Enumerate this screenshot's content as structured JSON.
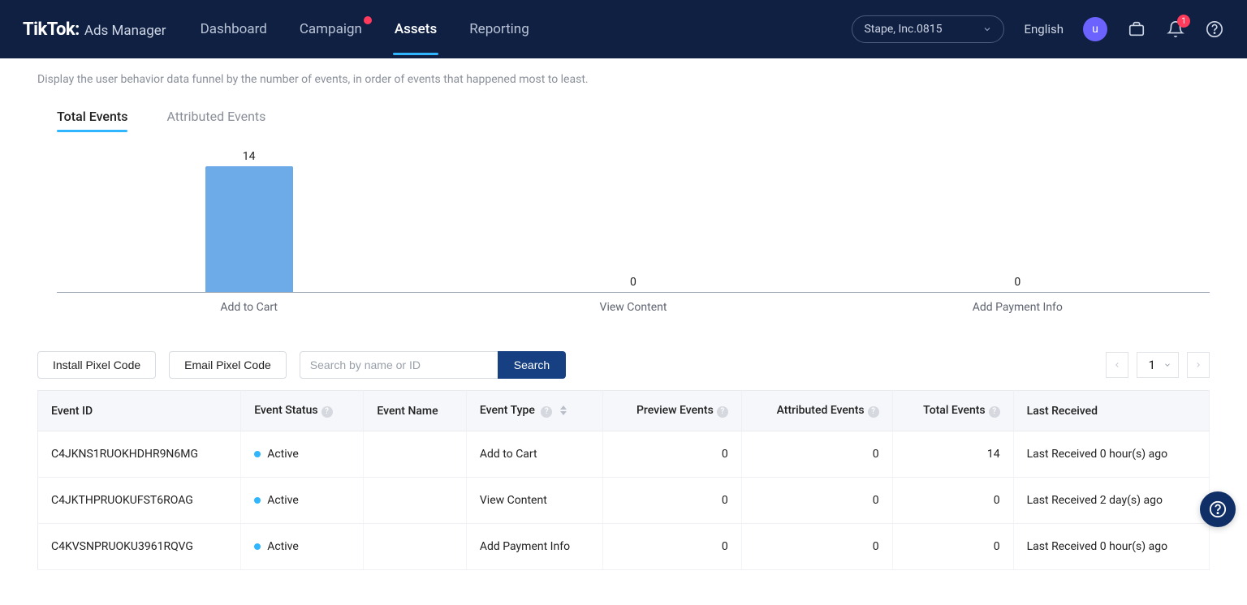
{
  "header": {
    "brand_main": "TikTok:",
    "brand_sub": "Ads Manager",
    "nav": [
      {
        "label": "Dashboard",
        "has_badge": false,
        "active": false
      },
      {
        "label": "Campaign",
        "has_badge": true,
        "active": false
      },
      {
        "label": "Assets",
        "has_badge": false,
        "active": true
      },
      {
        "label": "Reporting",
        "has_badge": false,
        "active": false
      }
    ],
    "account_name": "Stape, Inc.0815",
    "language": "English",
    "avatar_initial": "u",
    "notif_count": "1"
  },
  "section": {
    "subtitle": "Display the user behavior data funnel by the number of events, in order of events that happened most to least.",
    "tabs": [
      {
        "label": "Total Events",
        "active": true
      },
      {
        "label": "Attributed Events",
        "active": false
      }
    ]
  },
  "chart_data": {
    "type": "bar",
    "categories": [
      "Add to Cart",
      "View Content",
      "Add Payment Info"
    ],
    "values": [
      14,
      0,
      0
    ],
    "title": "",
    "xlabel": "",
    "ylabel": "",
    "ylim": [
      0,
      14
    ]
  },
  "toolbar": {
    "install_label": "Install Pixel Code",
    "email_label": "Email Pixel Code",
    "search_placeholder": "Search by name or ID",
    "search_btn": "Search",
    "page": "1"
  },
  "table": {
    "headers": {
      "event_id": "Event ID",
      "event_status": "Event Status",
      "event_name": "Event Name",
      "event_type": "Event Type",
      "preview_events": "Preview Events",
      "attributed_events": "Attributed Events",
      "total_events": "Total Events",
      "last_received": "Last Received"
    },
    "rows": [
      {
        "event_id": "C4JKNS1RUOKHDHR9N6MG",
        "status": "Active",
        "name": "",
        "type": "Add to Cart",
        "preview": "0",
        "attributed": "0",
        "total": "14",
        "last": "Last Received 0 hour(s) ago"
      },
      {
        "event_id": "C4JKTHPRUOKUFST6ROAG",
        "status": "Active",
        "name": "",
        "type": "View Content",
        "preview": "0",
        "attributed": "0",
        "total": "0",
        "last": "Last Received 2 day(s) ago"
      },
      {
        "event_id": "C4KVSNPRUOKU3961RQVG",
        "status": "Active",
        "name": "",
        "type": "Add Payment Info",
        "preview": "0",
        "attributed": "0",
        "total": "0",
        "last": "Last Received 0 hour(s) ago"
      }
    ]
  }
}
